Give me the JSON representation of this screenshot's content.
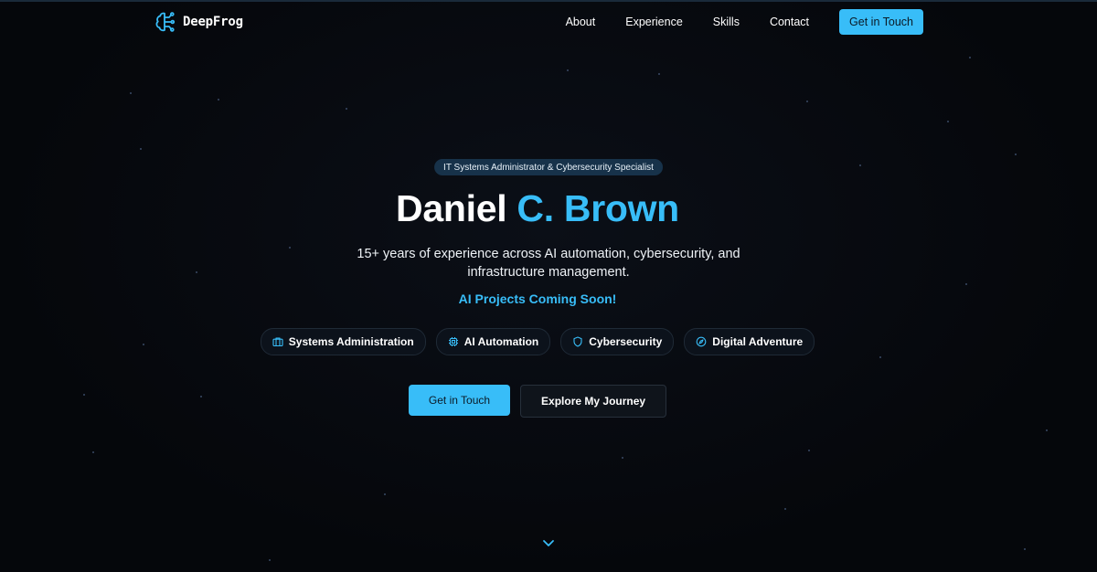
{
  "header": {
    "brand": "DeepFrog",
    "nav": [
      {
        "label": "About"
      },
      {
        "label": "Experience"
      },
      {
        "label": "Skills"
      },
      {
        "label": "Contact"
      }
    ],
    "cta_label": "Get in Touch"
  },
  "hero": {
    "badge": "IT Systems Administrator & Cybersecurity Specialist",
    "name_first": "Daniel",
    "name_accent": "C. Brown",
    "subtitle": "15+ years of experience across AI automation, cybersecurity, and infrastructure management.",
    "coming_soon": "AI Projects Coming Soon!",
    "chips": [
      {
        "label": "Systems Administration",
        "icon": "briefcase-icon"
      },
      {
        "label": "AI Automation",
        "icon": "cpu-icon"
      },
      {
        "label": "Cybersecurity",
        "icon": "shield-icon"
      },
      {
        "label": "Digital Adventure",
        "icon": "compass-icon"
      }
    ],
    "primary_button": "Get in Touch",
    "secondary_button": "Explore My Journey"
  },
  "colors": {
    "background": "#06080d",
    "accent": "#38bdf8",
    "text": "#ffffff"
  }
}
